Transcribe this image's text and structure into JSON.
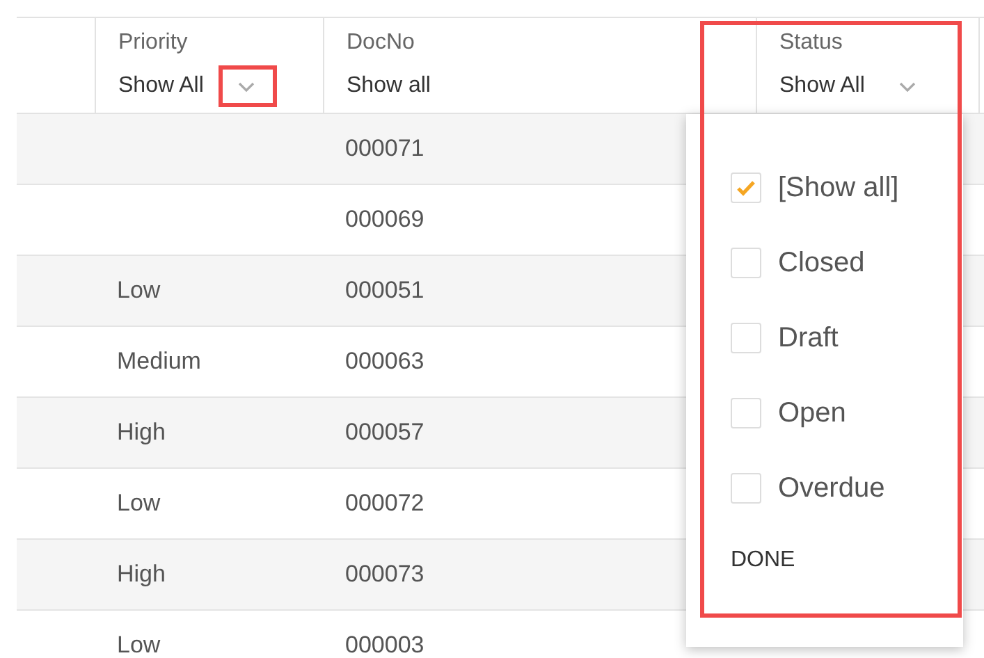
{
  "table": {
    "columns": [
      {
        "title": "Priority",
        "filter": "Show All",
        "highlighted": true
      },
      {
        "title": "DocNo",
        "filter": "Show all",
        "highlighted": false
      },
      {
        "title": "Status",
        "filter": "Show All",
        "highlighted": false
      }
    ],
    "rows": [
      {
        "priority": "",
        "docno": "000071"
      },
      {
        "priority": "",
        "docno": "000069"
      },
      {
        "priority": "Low",
        "docno": "000051"
      },
      {
        "priority": "Medium",
        "docno": "000063"
      },
      {
        "priority": "High",
        "docno": "000057"
      },
      {
        "priority": "Low",
        "docno": "000072"
      },
      {
        "priority": "High",
        "docno": "000073"
      },
      {
        "priority": "Low",
        "docno": "000003"
      }
    ]
  },
  "status_filter_menu": {
    "highlighted": true,
    "options": [
      {
        "label": "[Show all]",
        "checked": true
      },
      {
        "label": "Closed",
        "checked": false
      },
      {
        "label": "Draft",
        "checked": false
      },
      {
        "label": "Open",
        "checked": false
      },
      {
        "label": "Overdue",
        "checked": false
      }
    ],
    "done_button": "DONE"
  }
}
